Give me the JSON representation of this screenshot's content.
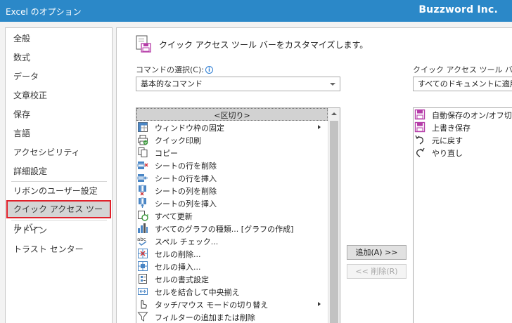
{
  "window": {
    "title": "Excel のオプション",
    "brand": "Buzzword Inc."
  },
  "nav": {
    "items": [
      {
        "label": "全般"
      },
      {
        "label": "数式"
      },
      {
        "label": "データ"
      },
      {
        "label": "文章校正"
      },
      {
        "label": "保存"
      },
      {
        "label": "言語"
      },
      {
        "label": "アクセシビリティ"
      },
      {
        "label": "詳細設定"
      },
      {
        "label": "リボンのユーザー設定"
      },
      {
        "label": "クイック アクセス ツール バー",
        "selected": true
      },
      {
        "label": "アドイン"
      },
      {
        "label": "トラスト センター"
      }
    ]
  },
  "header": {
    "title": "クイック アクセス ツール バーをカスタマイズします。"
  },
  "left_panel": {
    "label": "コマンドの選択(C):",
    "selected_source": "基本的なコマンド",
    "commands": [
      {
        "label": "<区切り>",
        "icon": "separator",
        "selected": true
      },
      {
        "label": "ウィンドウ枠の固定",
        "icon": "freeze-panes-icon",
        "submenu": true
      },
      {
        "label": "クイック印刷",
        "icon": "quick-print-icon"
      },
      {
        "label": "コピー",
        "icon": "copy-icon"
      },
      {
        "label": "シートの行を削除",
        "icon": "delete-row-icon"
      },
      {
        "label": "シートの行を挿入",
        "icon": "insert-row-icon"
      },
      {
        "label": "シートの列を削除",
        "icon": "delete-column-icon"
      },
      {
        "label": "シートの列を挿入",
        "icon": "insert-column-icon"
      },
      {
        "label": "すべて更新",
        "icon": "refresh-all-icon"
      },
      {
        "label": "すべてのグラフの種類... [グラフの作成]",
        "icon": "chart-icon"
      },
      {
        "label": "スペル チェック...",
        "icon": "spelling-icon"
      },
      {
        "label": "セルの削除...",
        "icon": "delete-cells-icon"
      },
      {
        "label": "セルの挿入...",
        "icon": "insert-cells-icon"
      },
      {
        "label": "セルの書式設定",
        "icon": "format-cells-icon"
      },
      {
        "label": "セルを結合して中央揃え",
        "icon": "merge-center-icon"
      },
      {
        "label": "タッチ/マウス モードの切り替え",
        "icon": "touch-mode-icon",
        "submenu": true
      },
      {
        "label": "フィルターの追加または削除",
        "icon": "filter-icon"
      }
    ]
  },
  "buttons": {
    "add": "追加(A) >>",
    "remove": "<< 削除(R)"
  },
  "right_panel": {
    "label": "クイック アクセス ツール バーのユ",
    "selected_target": "すべてのドキュメントに適用 (既",
    "commands": [
      {
        "label": "自動保存のオン/オフ切り",
        "icon": "autosave-icon"
      },
      {
        "label": "上書き保存",
        "icon": "save-icon"
      },
      {
        "label": "元に戻す",
        "icon": "undo-icon"
      },
      {
        "label": "やり直し",
        "icon": "redo-icon"
      }
    ]
  }
}
